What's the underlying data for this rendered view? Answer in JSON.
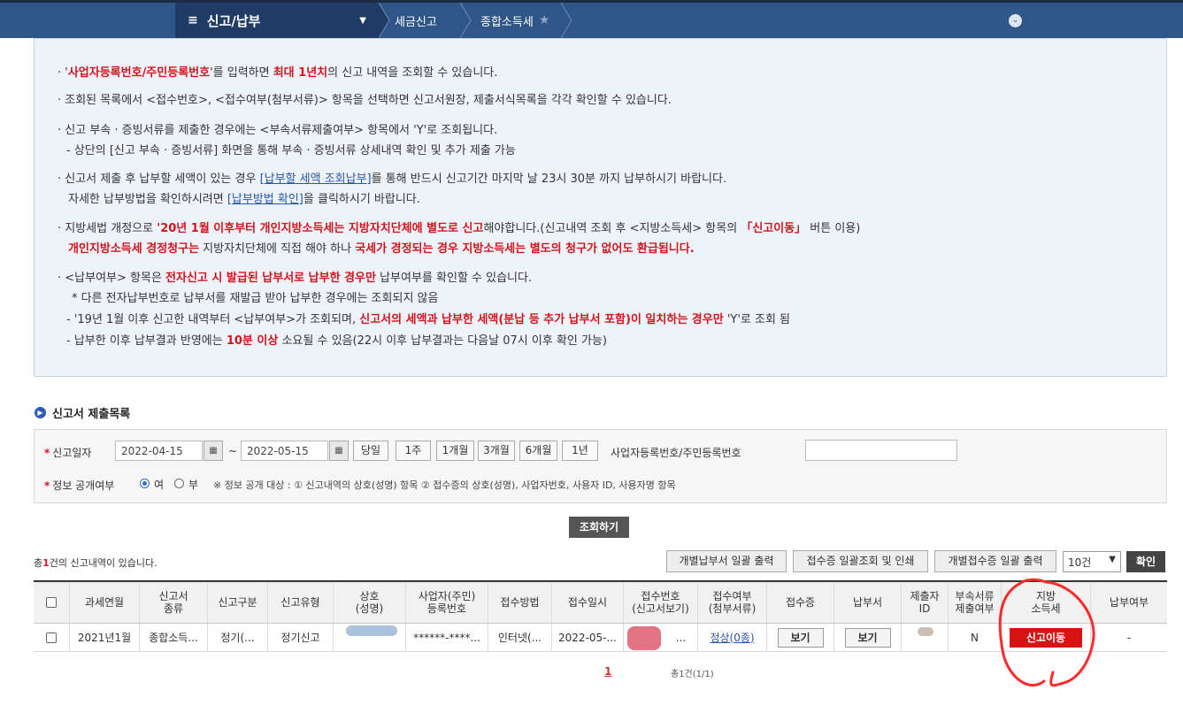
{
  "nav": {
    "menu_label": "신고/납부",
    "crumb1": "세금신고",
    "crumb2": "종합소득세"
  },
  "notice": {
    "l1": [
      "'",
      "사업자등록번호/주민등록번호",
      "'를 입력하면 ",
      "최대 1년치",
      "의 신고 내역을 조회할 수 있습니다."
    ],
    "l2": "조회된 목록에서 <접수번호>, <접수여부(첨부서류)> 항목을 선택하면 신고서원장, 제출서식목록을 각각 확인할 수 있습니다.",
    "l3": "신고 부속 · 증빙서류를 제출한 경우에는 <부속서류제출여부> 항목에서 'Y'로 조회됩니다.",
    "l4": "- 상단의 [신고 부속 · 증빙서류] 화면을 통해 부속 · 증빙서류 상세내역 확인 및 추가 제출 가능",
    "l5": [
      "신고서 제출 후 납부할 세액이 있는 경우 ",
      "[납부할 세액 조회납부]",
      "를 통해 반드시 신고기간 마지막 날 23시 30분 까지 납부하시기 바랍니다."
    ],
    "l6": [
      "자세한 납부방법을 확인하시려면 ",
      "[납부방법 확인]",
      "을 클릭하시기 바랍니다."
    ],
    "l7": [
      "지방세법 개정으로 ",
      "'20년 1월 이후부터 개인지방소득세는 지방자치단체에 별도로 신고",
      "해야합니다.(신고내역 조회 후 <지방소득세> 항목의 ",
      "「신고이동」",
      " 버튼 이용)"
    ],
    "l8": [
      "개인지방소득세 경정청구는",
      " 지방자치단체에 직접 해야 하나 ",
      "국세가 경정되는 경우 지방소득세는 별도의 청구가 없어도 환급됩니다."
    ],
    "l9": [
      "<납부여부> 항목은 ",
      "전자신고 시 발급된 납부서로 납부한 경우만",
      " 납부여부를 확인할 수 있습니다."
    ],
    "l10": "* 다른 전자납부번호로 납부서를 재발급 받아 납부한 경우에는 조회되지 않음",
    "l11": [
      "- '19년 1월 이후 신고한 내역부터 <납부여부>가 조회되며, ",
      "신고서의 세액과 납부한 세액(분납 등 추가 납부서 포함)이 일치하는 경우만",
      " 'Y'로 조회 됨"
    ],
    "l12": [
      "- 납부한 이후 납부결과 반영에는 ",
      "10분 이상",
      " 소요될 수 있음(22시 이후 납부결과는 다음날 07시 이후 확인 가능)"
    ]
  },
  "section_title": "신고서 제출목록",
  "search": {
    "date_label": "신고일자",
    "date_from": "2022-04-15",
    "date_to": "2022-05-15",
    "tilde": "~",
    "periods": [
      "당일",
      "1주",
      "1개월",
      "3개월",
      "6개월",
      "1년"
    ],
    "reg_label": "사업자등록번호/주민등록번호",
    "disclosure_label": "정보 공개여부",
    "opt_yes": "여",
    "opt_no": "부",
    "note": "※ 정보 공개 대상 : ① 신고내역의 상호(성명) 항목 ② 접수증의 상호(성명), 사업자번호, 사용자 ID, 사용자명 항목",
    "query_btn": "조회하기"
  },
  "results": {
    "total_pre": "총",
    "total_count": "1",
    "total_post": "건의 신고내역이 있습니다.",
    "btn_print_payment": "개별납부서 일괄 출력",
    "btn_print_receipt_lookup": "접수증 일괄조회 및 인쇄",
    "btn_print_receipt": "개별접수증 일괄 출력",
    "page_size": "10건",
    "confirm": "확인"
  },
  "table": {
    "headers": [
      "과세연월",
      "신고서\n종류",
      "신고구분",
      "신고유형",
      "상호\n(성명)",
      "사업자(주민)\n등록번호",
      "접수방법",
      "접수일시",
      "접수번호\n(신고서보기)",
      "접수여부\n(첨부서류)",
      "접수증",
      "납부서",
      "제출자\nID",
      "부속서류\n제출여부",
      "지방\n소득세",
      "납부여부"
    ],
    "row": {
      "period": "2021년1월",
      "form_type": "종합소득...",
      "category": "정기(...",
      "type": "정기신고",
      "reg_no": "******-****...",
      "method": "인터넷(...",
      "datetime": "2022-05-...",
      "receipt_no": "...",
      "status": "정상(0종)",
      "view1": "보기",
      "view2": "보기",
      "attach": "N",
      "local_tax_btn": "신고이동",
      "paid": "-"
    }
  },
  "pagination": {
    "page": "1",
    "info": "총1건(1/1)"
  }
}
